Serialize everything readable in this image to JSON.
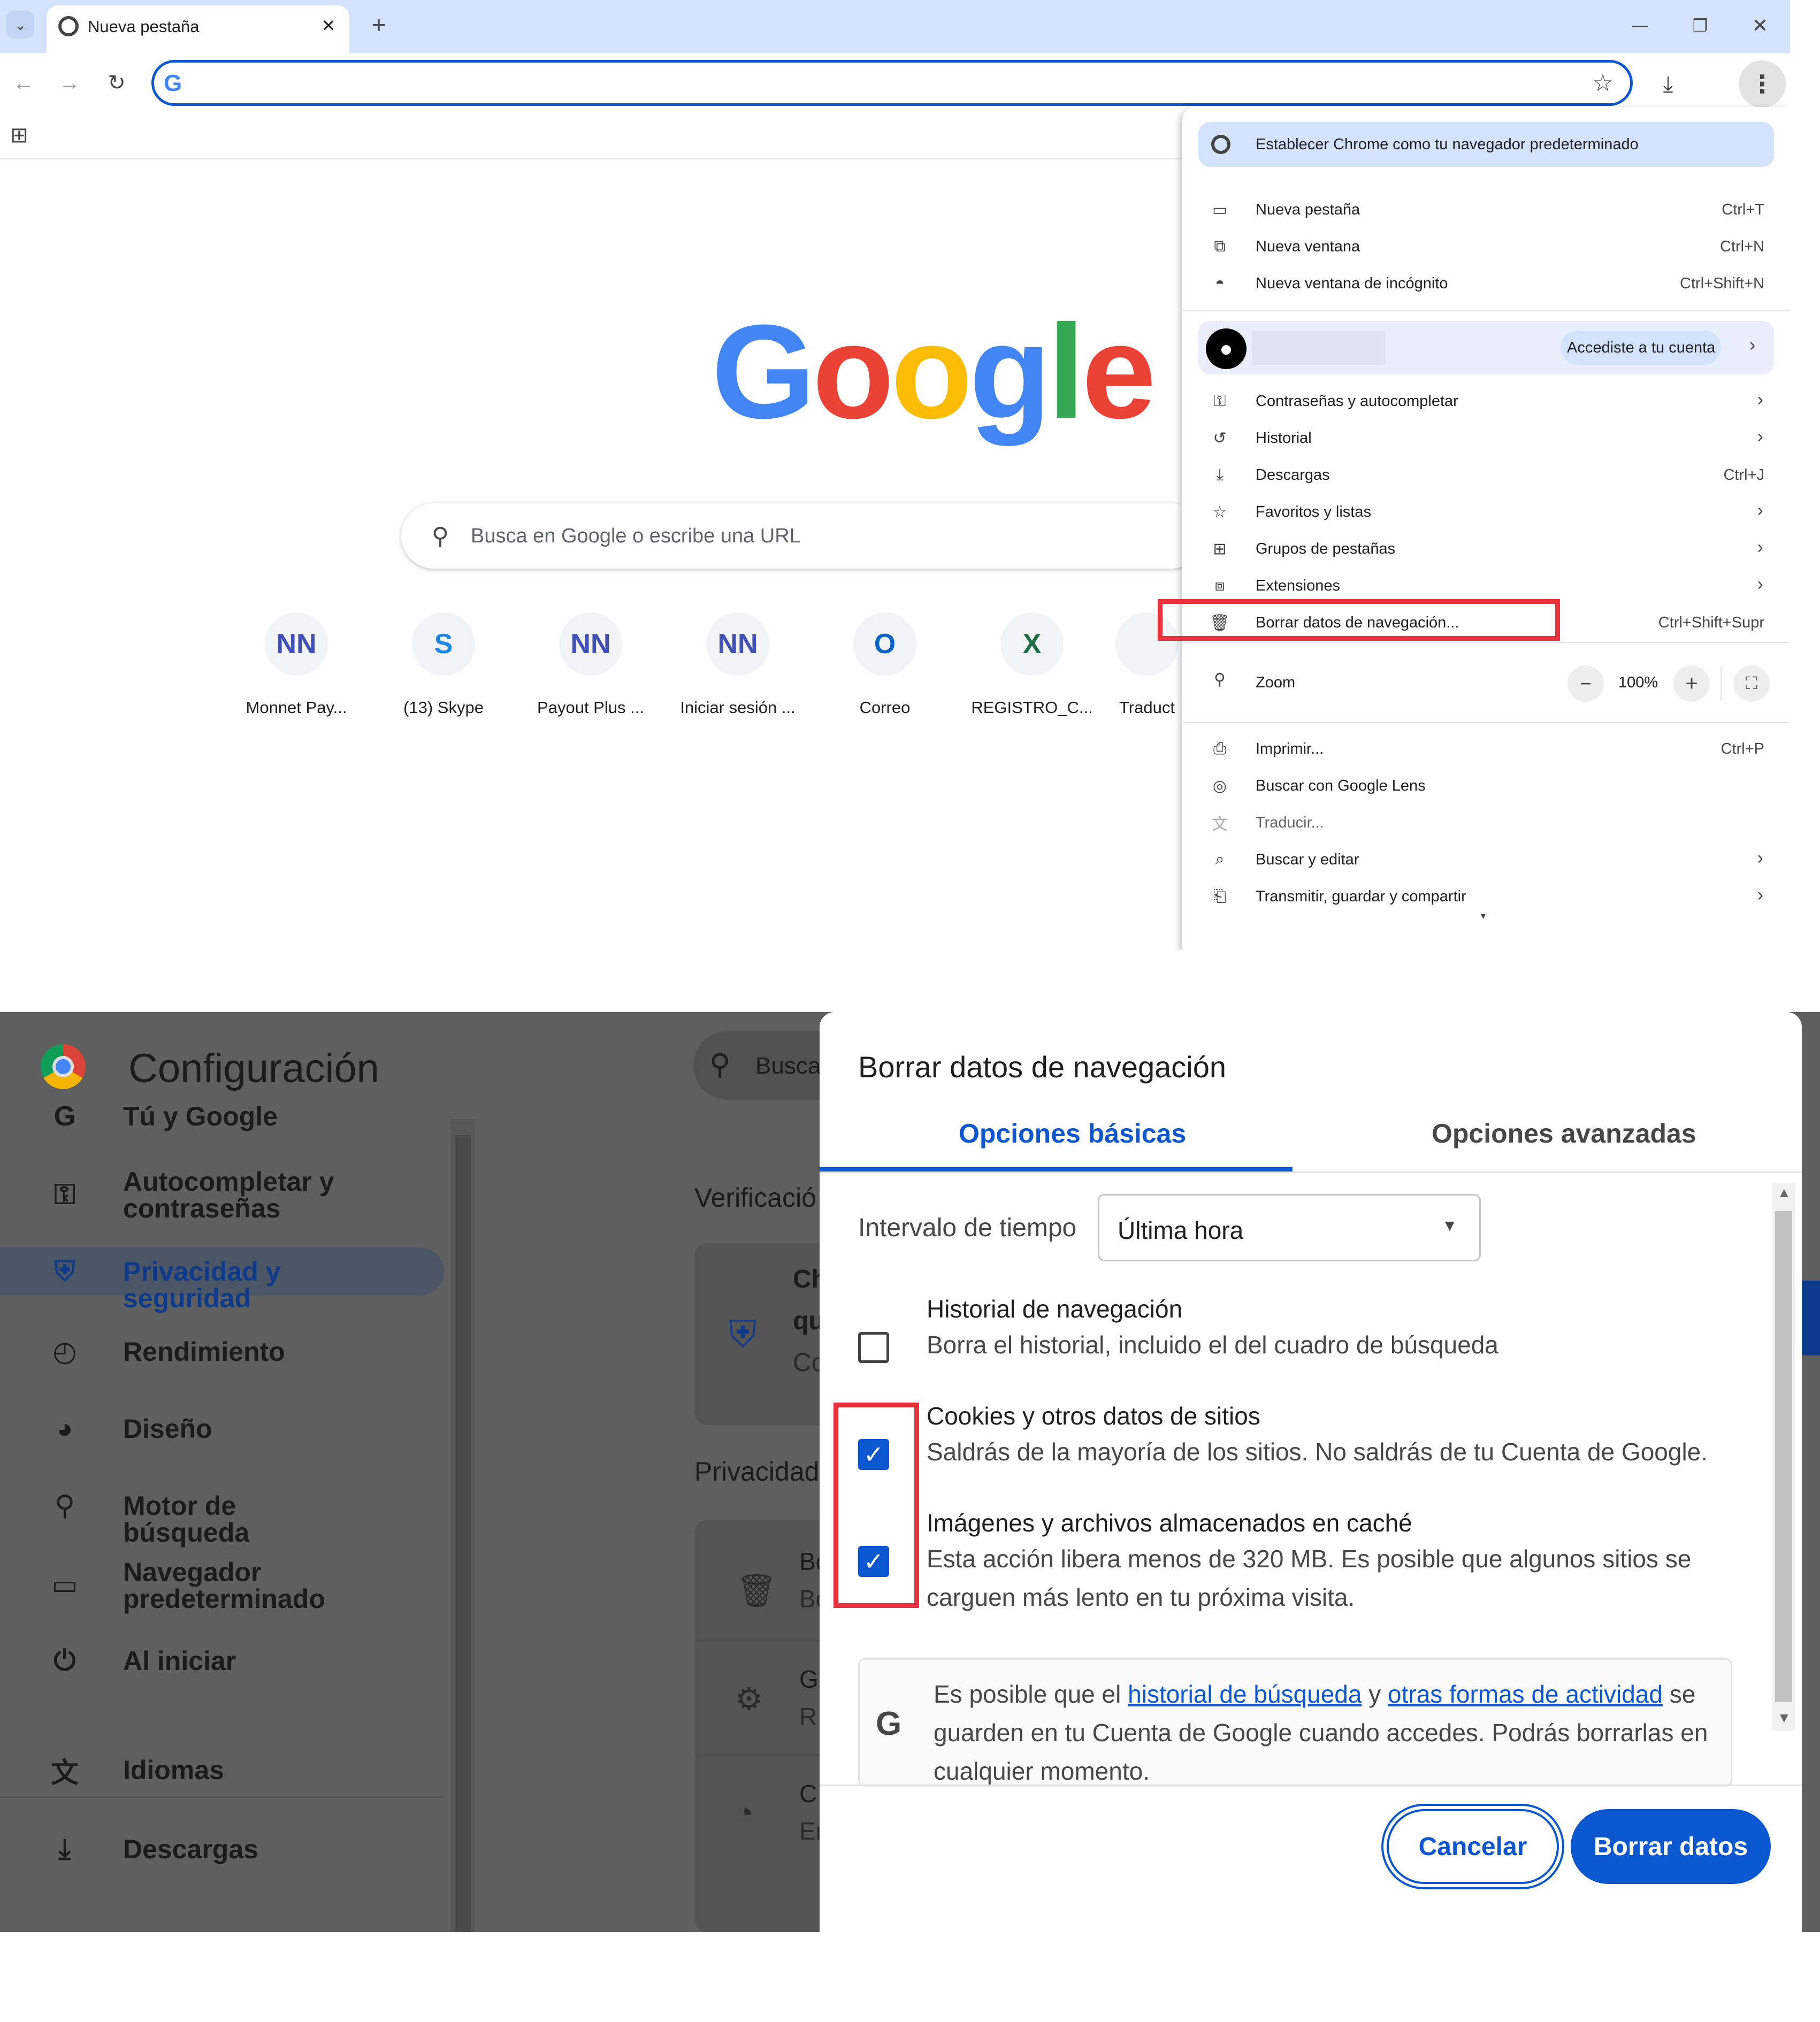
{
  "browser": {
    "tab_title": "Nueva pestaña",
    "new_tab_symbol": "+",
    "close_tab_symbol": "✕",
    "window_controls": {
      "minimize": "—",
      "restore": "❐",
      "close": "✕"
    }
  },
  "newtab": {
    "search_placeholder": "Busca en Google o escribe una URL",
    "logo": [
      "G",
      "o",
      "o",
      "g",
      "l",
      "e"
    ],
    "logo_colors": [
      "#4285f4",
      "#ea4335",
      "#fbbc05",
      "#4285f4",
      "#34a853",
      "#ea4335"
    ],
    "shortcuts": [
      {
        "label": "Monnet Pay...",
        "icon": "NN",
        "color": "#3f51b5"
      },
      {
        "label": "(13) Skype",
        "icon": "S",
        "color": "#1e88e5"
      },
      {
        "label": "Payout Plus ...",
        "icon": "NN",
        "color": "#3f51b5"
      },
      {
        "label": "Iniciar sesión ...",
        "icon": "NN",
        "color": "#3f51b5"
      },
      {
        "label": "Correo",
        "icon": "O",
        "color": "#0a64c8"
      },
      {
        "label": "REGISTRO_C...",
        "icon": "X",
        "color": "#1d7044"
      },
      {
        "label": "Traduct",
        "icon": "",
        "color": "#5f6368"
      }
    ]
  },
  "menu": {
    "banner": "Establecer Chrome como tu navegador predeterminado",
    "items_group1": [
      {
        "label": "Nueva pestaña",
        "shortcut": "Ctrl+T",
        "icon": "new-tab-icon"
      },
      {
        "label": "Nueva ventana",
        "shortcut": "Ctrl+N",
        "icon": "new-window-icon"
      },
      {
        "label": "Nueva ventana de incógnito",
        "shortcut": "Ctrl+Shift+N",
        "icon": "incognito-icon"
      }
    ],
    "account_button": "Accediste a tu cuenta",
    "items_group2": [
      {
        "label": "Contraseñas y autocompletar",
        "shortcut": "",
        "icon": "key-icon",
        "arrow": true
      },
      {
        "label": "Historial",
        "shortcut": "",
        "icon": "history-icon",
        "arrow": true
      },
      {
        "label": "Descargas",
        "shortcut": "Ctrl+J",
        "icon": "download-icon",
        "arrow": false
      },
      {
        "label": "Favoritos y listas",
        "shortcut": "",
        "icon": "star-icon",
        "arrow": true
      },
      {
        "label": "Grupos de pestañas",
        "shortcut": "",
        "icon": "tab-groups-icon",
        "arrow": true
      },
      {
        "label": "Extensiones",
        "shortcut": "",
        "icon": "puzzle-icon",
        "arrow": true
      },
      {
        "label": "Borrar datos de navegación...",
        "shortcut": "Ctrl+Shift+Supr",
        "icon": "trash-icon",
        "arrow": false
      }
    ],
    "zoom_label": "Zoom",
    "zoom_value": "100%",
    "zoom_minus": "−",
    "zoom_plus": "+",
    "items_group3": [
      {
        "label": "Imprimir...",
        "shortcut": "Ctrl+P",
        "icon": "print-icon",
        "arrow": false
      },
      {
        "label": "Buscar con Google Lens",
        "shortcut": "",
        "icon": "lens-icon",
        "arrow": false
      },
      {
        "label": "Traducir...",
        "shortcut": "",
        "icon": "translate-icon",
        "arrow": false
      },
      {
        "label": "Buscar y editar",
        "shortcut": "",
        "icon": "find-edit-icon",
        "arrow": true
      },
      {
        "label": "Transmitir, guardar y compartir",
        "shortcut": "",
        "icon": "cast-save-share-icon",
        "arrow": true
      }
    ]
  },
  "settings": {
    "title": "Configuración",
    "search_placeholder": "Busca",
    "nav": [
      {
        "label": "Tú y Google",
        "icon": "google-g-icon"
      },
      {
        "label": "Autocompletar y contraseñas",
        "icon": "key-icon"
      },
      {
        "label": "Privacidad y seguridad",
        "icon": "shield-icon",
        "active": true
      },
      {
        "label": "Rendimiento",
        "icon": "gauge-icon"
      },
      {
        "label": "Diseño",
        "icon": "palette-icon"
      },
      {
        "label": "Motor de búsqueda",
        "icon": "search-icon"
      },
      {
        "label": "Navegador predeterminado",
        "icon": "browser-window-icon"
      },
      {
        "label": "Al iniciar",
        "icon": "power-icon"
      },
      {
        "label": "Idiomas",
        "icon": "language-icon"
      },
      {
        "label": "Descargas",
        "icon": "download-icon"
      }
    ],
    "bg_fragments": {
      "verificacion": "Verificació",
      "privacidad": "Privacidad",
      "card1": [
        "Ch",
        "qu",
        "Co"
      ],
      "row1": [
        "Bo",
        "Bo"
      ],
      "row2": [
        "G",
        "R"
      ],
      "row3": [
        "C",
        "Er"
      ]
    }
  },
  "dialog": {
    "title": "Borrar datos de navegación",
    "tab_basic": "Opciones básicas",
    "tab_advanced": "Opciones avanzadas",
    "time_range_label": "Intervalo de tiempo",
    "time_range_value": "Última hora",
    "items": [
      {
        "title": "Historial de navegación",
        "desc": "Borra el historial, incluido el del cuadro de búsqueda",
        "checked": false
      },
      {
        "title": "Cookies y otros datos de sitios",
        "desc": "Saldrás de la mayoría de los sitios. No saldrás de tu Cuenta de Google.",
        "checked": true
      },
      {
        "title": "Imágenes y archivos almacenados en caché",
        "desc": "Esta acción libera menos de 320 MB. Es posible que algunos sitios se carguen más lento en tu próxima visita.",
        "checked": true
      }
    ],
    "info_part1": "Es posible que el ",
    "info_link1": "historial de búsqueda",
    "info_part2": " y ",
    "info_link2": "otras formas de actividad",
    "info_part3": " se guarden en tu Cuenta de Google cuando accedes. Podrás borrarlas en cualquier momento.",
    "cancel_label": "Cancelar",
    "confirm_label": "Borrar datos"
  },
  "colors": {
    "accent": "#0b57d0",
    "highlight": "#e8323c",
    "tabstrip": "#d3e3fd"
  }
}
